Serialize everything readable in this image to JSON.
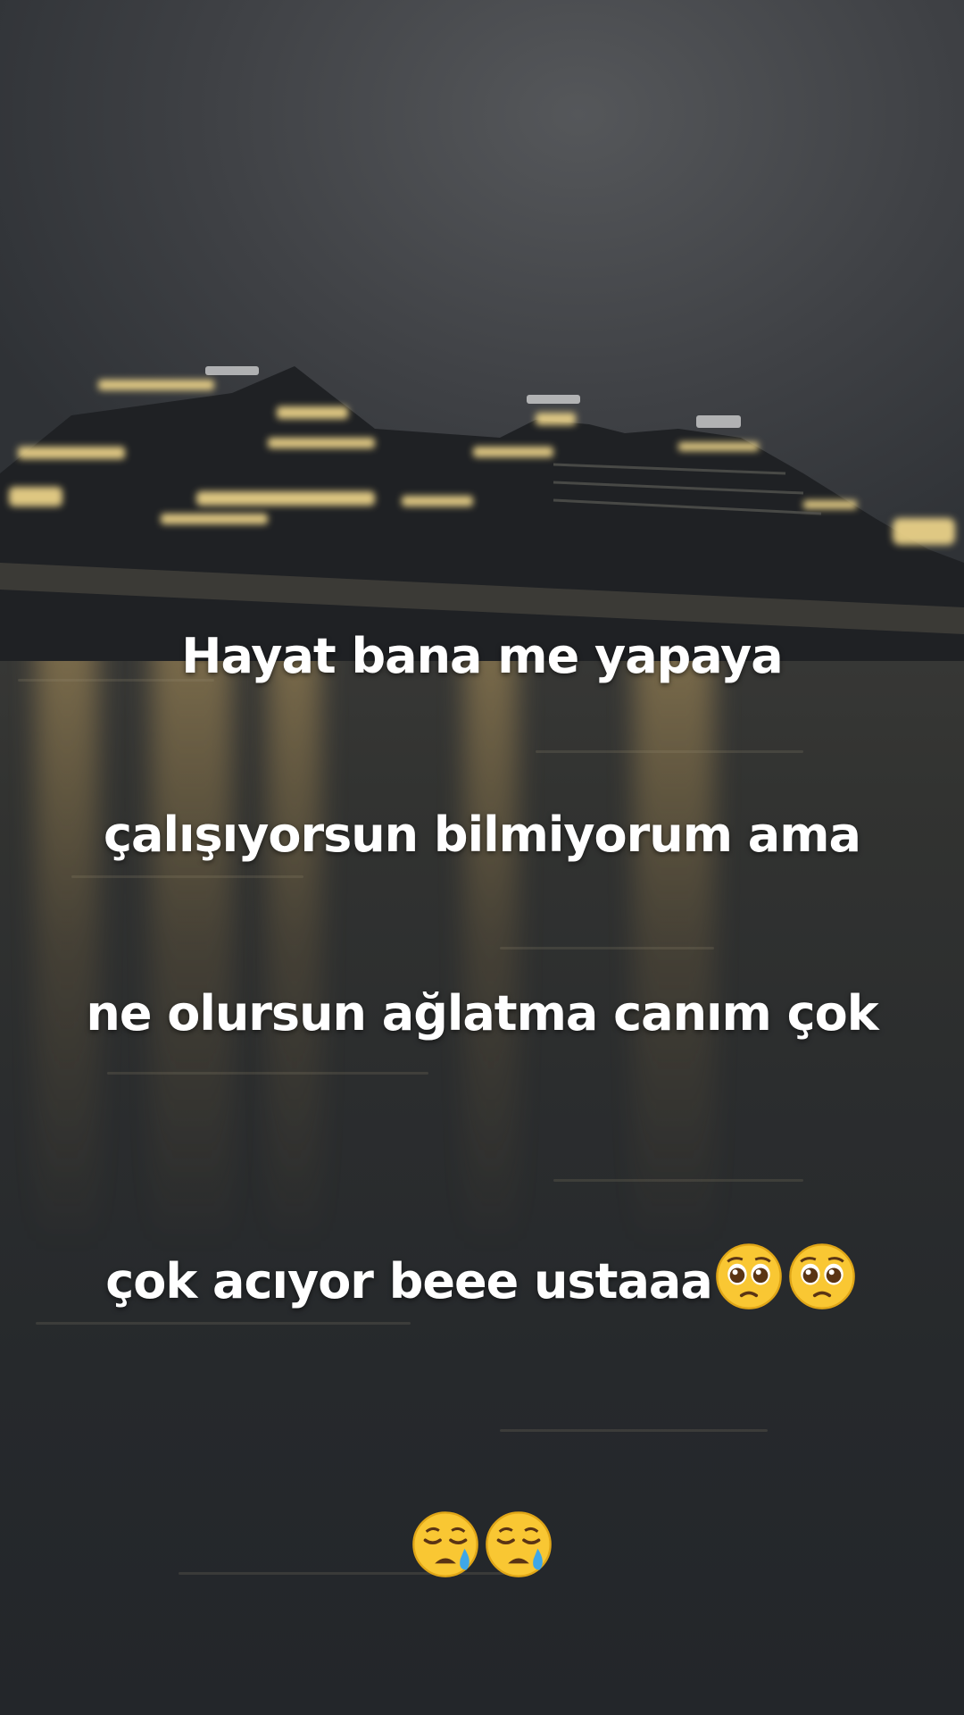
{
  "caption": {
    "line1": "Hayat bana me yapaya",
    "line2": "çalışıyorsun bilmiyorum ama",
    "line3": "ne olursun ağlatma canım çok",
    "line4": "çok acıyor beee ustaaa"
  },
  "icons": {
    "pleading": "pleading-face-emoji",
    "crying": "sleepy-crying-face-emoji"
  },
  "colors": {
    "text": "#ffffff",
    "ship_lights": "#f3d98c",
    "water": "#2b2d2e"
  }
}
